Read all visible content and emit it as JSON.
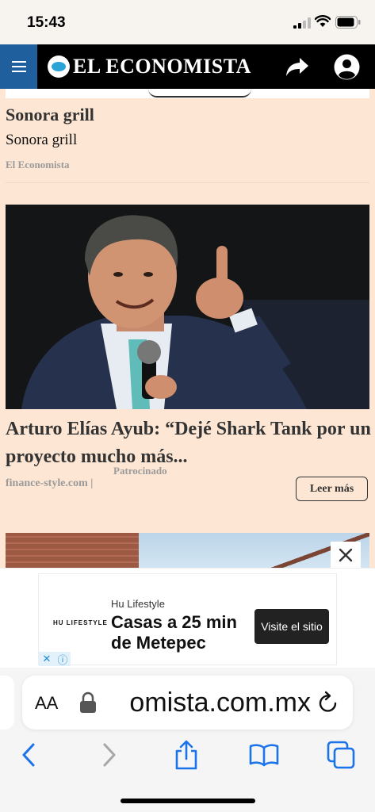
{
  "status_bar": {
    "time": "15:43"
  },
  "header": {
    "logo_text": "EL ECONOMISTA"
  },
  "card1": {
    "title": "Sonora grill",
    "subtitle": "Sonora grill",
    "source": "El Economista"
  },
  "card2": {
    "title": "Arturo Elías Ayub: “Dejé Shark Tank por un proyecto mucho más...",
    "sponsored": "Patrocinado",
    "source": "finance-style.com |",
    "cta": "Leer más"
  },
  "ad": {
    "logo": "HU LIFESTYLE",
    "brand": "Hu Lifestyle",
    "headline": "Casas a 25 min de Metepec",
    "cta": "Visite el sitio"
  },
  "browser": {
    "text_size": "AA",
    "url": "omista.com.mx"
  },
  "colors": {
    "accent_blue": "#1f5f9e",
    "card_background": "#fde6d3",
    "ios_blue": "#1a73e8"
  }
}
